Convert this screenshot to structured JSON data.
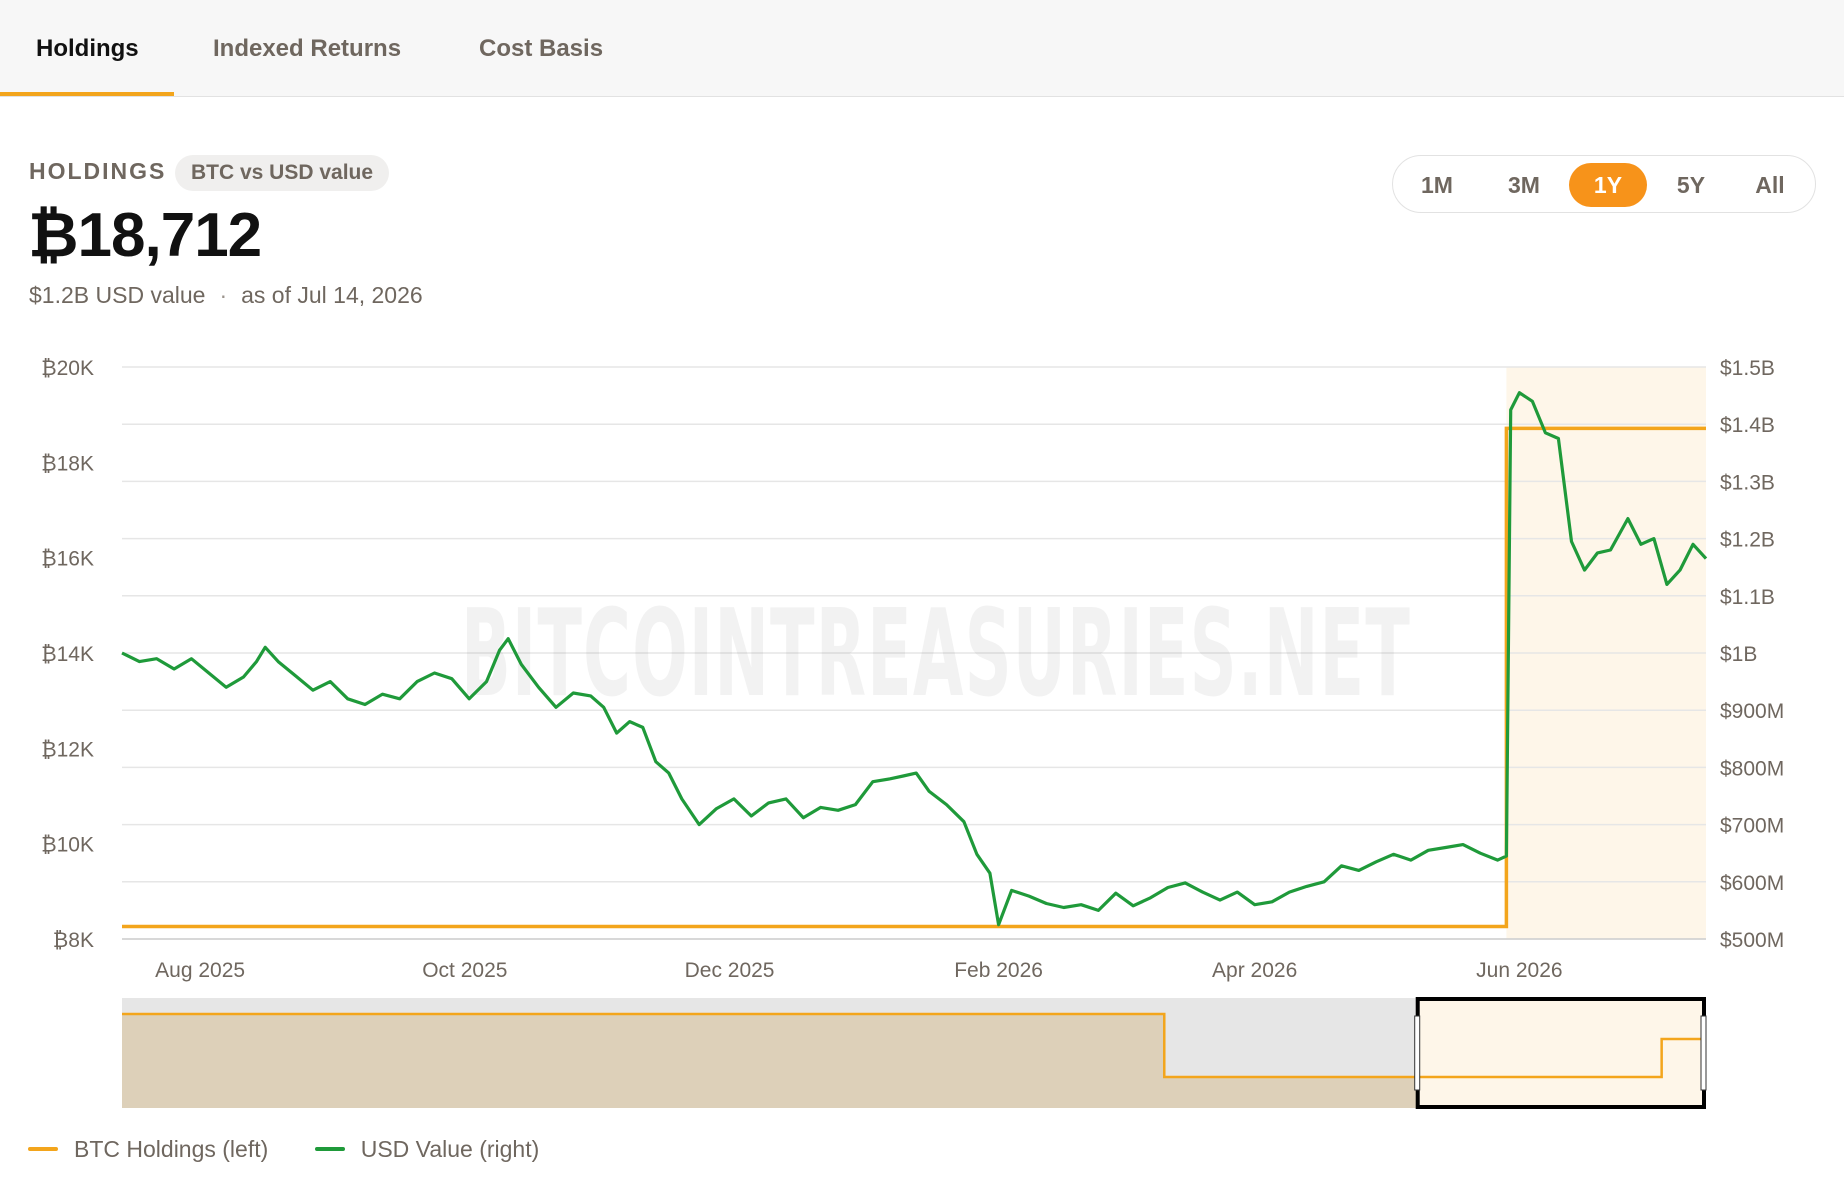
{
  "tabs": [
    {
      "label": "Holdings",
      "active": true
    },
    {
      "label": "Indexed Returns",
      "active": false
    },
    {
      "label": "Cost Basis",
      "active": false
    }
  ],
  "header": {
    "title": "HOLDINGS",
    "pill": "BTC vs USD value",
    "value": "₿18,712",
    "usd_value": "$1.2B USD value",
    "separator": "·",
    "as_of": "as of Jul 14, 2026"
  },
  "ranges": [
    {
      "label": "1M",
      "active": false
    },
    {
      "label": "3M",
      "active": false
    },
    {
      "label": "1Y",
      "active": true
    },
    {
      "label": "5Y",
      "active": false
    },
    {
      "label": "All",
      "active": false
    }
  ],
  "watermark": "BITCOINTREASURIES.NET",
  "colors": {
    "accent": "#f7931a",
    "btc_line": "#f3a51c",
    "usd_line": "#1f9a3a",
    "highlight_fill": "#fef6e9",
    "navigator_fill": "#ddd0b9"
  },
  "chart_data": {
    "type": "line",
    "x_axis": {
      "type": "date",
      "range": [
        "2025-07-14",
        "2026-07-14"
      ],
      "tick_labels": [
        "Aug 2025",
        "Oct 2025",
        "Dec 2025",
        "Feb 2026",
        "Apr 2026",
        "Jun 2026"
      ],
      "tick_dates": [
        "2025-08-01",
        "2025-10-01",
        "2025-12-01",
        "2026-02-01",
        "2026-04-01",
        "2026-06-01"
      ]
    },
    "y_left": {
      "min": 8000,
      "max": 20000,
      "ticks": [
        8000,
        10000,
        12000,
        14000,
        16000,
        18000,
        20000
      ],
      "tick_labels": [
        "₿8K",
        "₿10K",
        "₿12K",
        "₿14K",
        "₿16K",
        "₿18K",
        "₿20K"
      ]
    },
    "y_right": {
      "min": 500,
      "max": 1500,
      "ticks": [
        500,
        600,
        700,
        800,
        900,
        1000,
        1100,
        1200,
        1300,
        1400,
        1500
      ],
      "tick_labels": [
        "$500M",
        "$600M",
        "$700M",
        "$800M",
        "$900M",
        "$1B",
        "$1.1B",
        "$1.2B",
        "$1.3B",
        "$1.4B",
        "$1.5B"
      ]
    },
    "grid": true,
    "legend_position": "bottom-left",
    "highlight_from": "2026-05-29",
    "series": [
      {
        "name": "BTC Holdings (left)",
        "axis": "left",
        "step": true,
        "points": [
          [
            "2025-07-14",
            8262
          ],
          [
            "2026-05-29",
            8262
          ],
          [
            "2026-05-29",
            18712
          ],
          [
            "2026-07-14",
            18712
          ]
        ]
      },
      {
        "name": "USD Value (right)",
        "axis": "right",
        "points": [
          [
            "2025-07-14",
            1000
          ],
          [
            "2025-07-18",
            985
          ],
          [
            "2025-07-22",
            990
          ],
          [
            "2025-07-26",
            972
          ],
          [
            "2025-07-30",
            990
          ],
          [
            "2025-08-03",
            965
          ],
          [
            "2025-08-07",
            940
          ],
          [
            "2025-08-11",
            958
          ],
          [
            "2025-08-14",
            985
          ],
          [
            "2025-08-16",
            1010
          ],
          [
            "2025-08-19",
            985
          ],
          [
            "2025-08-23",
            960
          ],
          [
            "2025-08-27",
            935
          ],
          [
            "2025-08-31",
            950
          ],
          [
            "2025-09-04",
            920
          ],
          [
            "2025-09-08",
            910
          ],
          [
            "2025-09-12",
            928
          ],
          [
            "2025-09-16",
            920
          ],
          [
            "2025-09-20",
            950
          ],
          [
            "2025-09-24",
            965
          ],
          [
            "2025-09-28",
            955
          ],
          [
            "2025-10-02",
            920
          ],
          [
            "2025-10-06",
            950
          ],
          [
            "2025-10-09",
            1005
          ],
          [
            "2025-10-11",
            1025
          ],
          [
            "2025-10-14",
            980
          ],
          [
            "2025-10-18",
            940
          ],
          [
            "2025-10-22",
            905
          ],
          [
            "2025-10-26",
            930
          ],
          [
            "2025-10-30",
            925
          ],
          [
            "2025-11-02",
            905
          ],
          [
            "2025-11-05",
            860
          ],
          [
            "2025-11-08",
            880
          ],
          [
            "2025-11-11",
            870
          ],
          [
            "2025-11-14",
            810
          ],
          [
            "2025-11-17",
            790
          ],
          [
            "2025-11-20",
            745
          ],
          [
            "2025-11-24",
            700
          ],
          [
            "2025-11-28",
            728
          ],
          [
            "2025-12-02",
            745
          ],
          [
            "2025-12-06",
            715
          ],
          [
            "2025-12-10",
            738
          ],
          [
            "2025-12-14",
            745
          ],
          [
            "2025-12-18",
            712
          ],
          [
            "2025-12-22",
            730
          ],
          [
            "2025-12-26",
            725
          ],
          [
            "2025-12-30",
            735
          ],
          [
            "2026-01-03",
            775
          ],
          [
            "2026-01-07",
            780
          ],
          [
            "2026-01-10",
            785
          ],
          [
            "2026-01-13",
            790
          ],
          [
            "2026-01-16",
            758
          ],
          [
            "2026-01-20",
            735
          ],
          [
            "2026-01-24",
            705
          ],
          [
            "2026-01-27",
            648
          ],
          [
            "2026-01-30",
            615
          ],
          [
            "2026-02-01",
            525
          ],
          [
            "2026-02-04",
            585
          ],
          [
            "2026-02-08",
            575
          ],
          [
            "2026-02-12",
            562
          ],
          [
            "2026-02-16",
            555
          ],
          [
            "2026-02-20",
            560
          ],
          [
            "2026-02-24",
            550
          ],
          [
            "2026-02-28",
            580
          ],
          [
            "2026-03-04",
            558
          ],
          [
            "2026-03-08",
            572
          ],
          [
            "2026-03-12",
            590
          ],
          [
            "2026-03-16",
            598
          ],
          [
            "2026-03-20",
            582
          ],
          [
            "2026-03-24",
            568
          ],
          [
            "2026-03-28",
            582
          ],
          [
            "2026-04-01",
            560
          ],
          [
            "2026-04-05",
            565
          ],
          [
            "2026-04-09",
            582
          ],
          [
            "2026-04-13",
            592
          ],
          [
            "2026-04-17",
            600
          ],
          [
            "2026-04-21",
            628
          ],
          [
            "2026-04-25",
            620
          ],
          [
            "2026-04-29",
            635
          ],
          [
            "2026-05-03",
            648
          ],
          [
            "2026-05-07",
            638
          ],
          [
            "2026-05-11",
            655
          ],
          [
            "2026-05-15",
            660
          ],
          [
            "2026-05-19",
            665
          ],
          [
            "2026-05-23",
            650
          ],
          [
            "2026-05-27",
            638
          ],
          [
            "2026-05-29",
            645
          ],
          [
            "2026-05-30",
            1425
          ],
          [
            "2026-06-01",
            1455
          ],
          [
            "2026-06-04",
            1440
          ],
          [
            "2026-06-07",
            1385
          ],
          [
            "2026-06-10",
            1375
          ],
          [
            "2026-06-13",
            1195
          ],
          [
            "2026-06-16",
            1145
          ],
          [
            "2026-06-19",
            1175
          ],
          [
            "2026-06-22",
            1180
          ],
          [
            "2026-06-26",
            1235
          ],
          [
            "2026-06-29",
            1190
          ],
          [
            "2026-07-02",
            1200
          ],
          [
            "2026-07-05",
            1120
          ],
          [
            "2026-07-08",
            1145
          ],
          [
            "2026-07-11",
            1190
          ],
          [
            "2026-07-14",
            1165
          ]
        ]
      }
    ]
  },
  "legend": [
    {
      "label": "BTC Holdings (left)",
      "color": "#f3a51c"
    },
    {
      "label": "USD Value (right)",
      "color": "#1f9a3a"
    }
  ]
}
